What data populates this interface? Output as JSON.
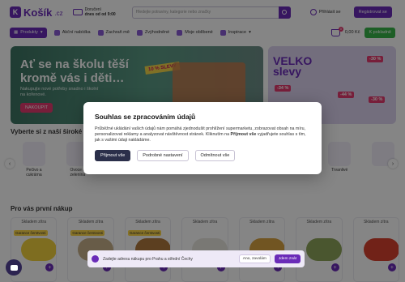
{
  "header": {
    "logo_text": "Košík",
    "logo_suffix": ".cz",
    "delivery_label": "Doručení",
    "delivery_time": "dnes od od 9:00",
    "search_placeholder": "Hledejte potraviny, kategorie nebo značky",
    "login_label": "Přihlásit se",
    "register_label": "Registrovat se"
  },
  "nav": {
    "products_label": "Produkty",
    "items": [
      "Akční nabídka",
      "Zachraň mě",
      "Zvýhodněné",
      "Moje oblíbené",
      "Inspirace"
    ],
    "cart_count": "0",
    "cart_price": "0,00 Kč",
    "checkout_label": "K pokladně"
  },
  "banner": {
    "title": "Ať se na školu těší kromě vás i děti…",
    "subtitle": "Nakupujte nové potřeby snadno i školní na kořenové.",
    "button": "NAKOUPIT",
    "tag": "10 % SLEVY"
  },
  "banner2": {
    "title_line1": "VELKO",
    "title_line2": "slevy",
    "badge1": "-30 %",
    "badge2": "-34 %",
    "badge3": "-44 %",
    "badge4": "-30 %"
  },
  "categories": {
    "title": "Vyberte si z naší široké nabídky",
    "items": [
      "Pečivo a cukrárna",
      "Ovoce a zelenina",
      "",
      "",
      "",
      "",
      "",
      "",
      "",
      "Trvanlivé",
      ""
    ]
  },
  "products": {
    "title": "Pro vás první nákup",
    "tag": "Skladem zítra",
    "badge": "Garance čerstvosti",
    "items": [
      {
        "color": "#f2d23f"
      },
      {
        "color": "#c8b08a"
      },
      {
        "color": "#b07a3e"
      },
      {
        "color": "#e9e6df"
      },
      {
        "color": "#d9a441"
      },
      {
        "color": "#8fa65a"
      },
      {
        "color": "#d8412e"
      }
    ]
  },
  "address_bar": {
    "text": "Zadejte adresu nákupu pro Prahu a střední Čechy",
    "later": "Ano, zavolám",
    "confirm": "Jdem znát"
  },
  "modal": {
    "title": "Souhlas se zpracováním údajů",
    "text_part1": "Průběžné ukládání vašich údajů nám pomáhá zjednodušit prohlížení supermarketu, zobrazovat obsah na míru, personalizovat reklamy a analyzovat návštěvnost stránek. Kliknutím na ",
    "text_bold": "Přijmout vše",
    "text_part2": " vyjadřujete souhlas s tím, jak s vašimi údaji nakládáme.",
    "accept": "Přijmout vše",
    "settings": "Podrobné nastavení",
    "reject": "Odmítnout vše"
  }
}
